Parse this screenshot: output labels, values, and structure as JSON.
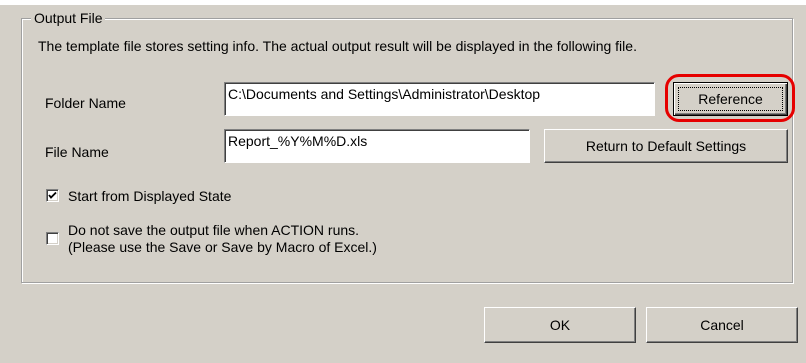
{
  "group": {
    "title": "Output File",
    "description": "The template file stores setting info. The actual output result will be displayed in the following file."
  },
  "folder": {
    "label": "Folder Name",
    "value": "C:\\Documents and Settings\\Administrator\\Desktop",
    "reference_label": "Reference"
  },
  "file": {
    "label": "File Name",
    "value": "Report_%Y%M%D.xls",
    "default_label": "Return to Default Settings"
  },
  "options": {
    "start_displayed": {
      "label": "Start from Displayed State",
      "checked": true
    },
    "no_save": {
      "label_line1": "Do not save the output file when ACTION runs.",
      "label_line2": "(Please use the Save or Save by Macro of Excel.)",
      "checked": false
    }
  },
  "footer": {
    "ok_label": "OK",
    "cancel_label": "Cancel"
  },
  "colors": {
    "dialog_bg": "#d4d0c8",
    "highlight": "#e60000"
  }
}
